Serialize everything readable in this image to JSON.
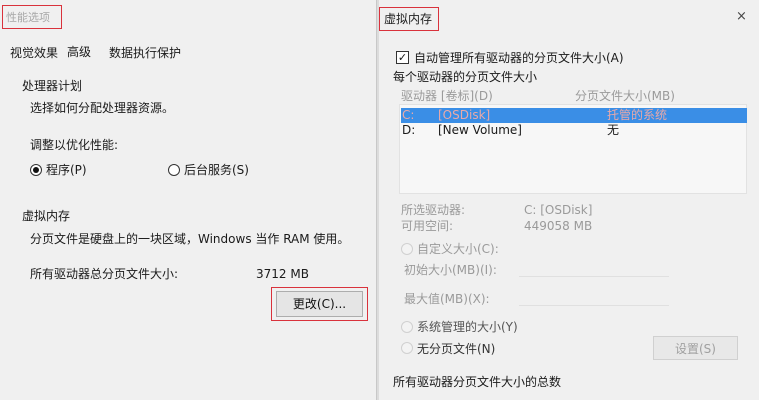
{
  "left": {
    "title": "性能选项",
    "tabs": [
      "视觉效果",
      "高级",
      "数据执行保护"
    ],
    "processor": {
      "heading": "处理器计划",
      "desc": "选择如何分配处理器资源。",
      "adjust_label": "调整以优化性能:",
      "option_programs": "程序(P)",
      "option_services": "后台服务(S)"
    },
    "vm": {
      "heading": "虚拟内存",
      "desc": "分页文件是硬盘上的一块区域，Windows 当作 RAM 使用。",
      "total_label": "所有驱动器总分页文件大小:",
      "total_value": "3712 MB",
      "change_button": "更改(C)..."
    }
  },
  "right": {
    "title": "虚拟内存",
    "close_symbol": "×",
    "auto_manage": "自动管理所有驱动器的分页文件大小(A)",
    "per_drive_heading": "每个驱动器的分页文件大小",
    "list_header_drive": "驱动器 [卷标](D)",
    "list_header_size": "分页文件大小(MB)",
    "drives": [
      {
        "letter": "C:",
        "label": "[OSDisk]",
        "size": "托管的系统"
      },
      {
        "letter": "D:",
        "label": "[New Volume]",
        "size": "无"
      }
    ],
    "selected_drive_label": "所选驱动器:",
    "selected_drive_value": "C:  [OSDisk]",
    "free_space_label": "可用空间:",
    "free_space_value": "449058 MB",
    "custom_size": "自定义大小(C):",
    "initial_size": "初始大小(MB)(I):",
    "max_size": "最大值(MB)(X):",
    "system_managed": "系统管理的大小(Y)",
    "no_paging": "无分页文件(N)",
    "set_button": "设置(S)",
    "total_heading": "所有驱动器分页文件大小的总数"
  }
}
